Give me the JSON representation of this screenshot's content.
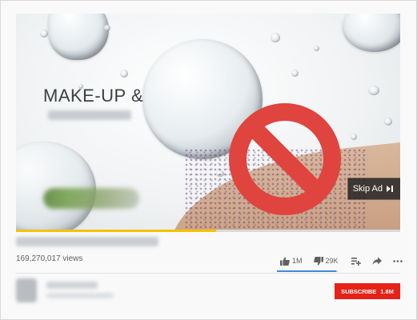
{
  "ad": {
    "headline": "MAKE-UP &",
    "skip_label": "Skip Ad",
    "skip_icon": "skip-next-icon",
    "overlay_icon": "prohibited-icon",
    "overlay_color": "#e0443e",
    "progress_fraction": 0.52,
    "progress_color": "#f4c200"
  },
  "video": {
    "views": "169,270,017 views",
    "like_count": "1M",
    "dislike_count": "29K",
    "like_ratio": 0.97,
    "like_bar_color": "#3e8bd6"
  },
  "actions": {
    "like_icon": "thumb-up-icon",
    "dislike_icon": "thumb-down-icon",
    "add_to_playlist_icon": "add-to-playlist-icon",
    "share_icon": "share-icon",
    "more_icon": "more-horizontal-icon"
  },
  "channel": {
    "subscribe_label": "SUBSCRIBE",
    "subscriber_count": "1.8M",
    "subscribe_color": "#e62117"
  }
}
